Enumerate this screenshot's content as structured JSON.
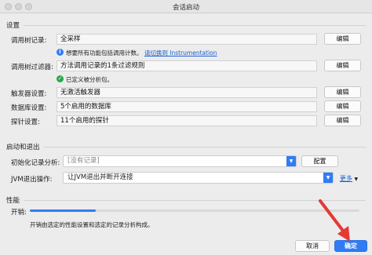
{
  "window": {
    "title": "会话启动"
  },
  "settings": {
    "heading": "设置",
    "call_tree_record": {
      "label": "调用树记录:",
      "value": "全采样",
      "edit": "编辑"
    },
    "hint": {
      "text": "想要所有功能包括调用计数。",
      "link": "请切换到 Instrumentation"
    },
    "call_tree_filter": {
      "label": "调用树过滤器:",
      "value": "方法调用记录的1条过滤规则",
      "edit": "编辑"
    },
    "filter_status": "已定义被分析包。",
    "trigger": {
      "label": "触发器设置:",
      "value": "无激活触发器",
      "edit": "编辑"
    },
    "database": {
      "label": "数据库设置:",
      "value": "5个启用的数据库",
      "edit": "编辑"
    },
    "probe": {
      "label": "探针设置:",
      "value": "11个启用的探针",
      "edit": "编辑"
    }
  },
  "startup": {
    "heading": "启动和退出",
    "init_record": {
      "label": "初始化记录分析:",
      "placeholder": "[没有记录]",
      "button": "配置"
    },
    "jvm_exit": {
      "label": "JVM退出操作:",
      "value": "让JVM退出并断开连接",
      "more": "更多"
    }
  },
  "performance": {
    "heading": "性能",
    "overhead_label": "开销:",
    "overhead_level": 0.2,
    "description": "开销由选定的性能设置和选定的记录分析构成。"
  },
  "footer": {
    "cancel": "取消",
    "ok": "确定"
  },
  "colors": {
    "accent": "#2f7cf6",
    "annotation": "#e53935",
    "success": "#2aa84a"
  }
}
